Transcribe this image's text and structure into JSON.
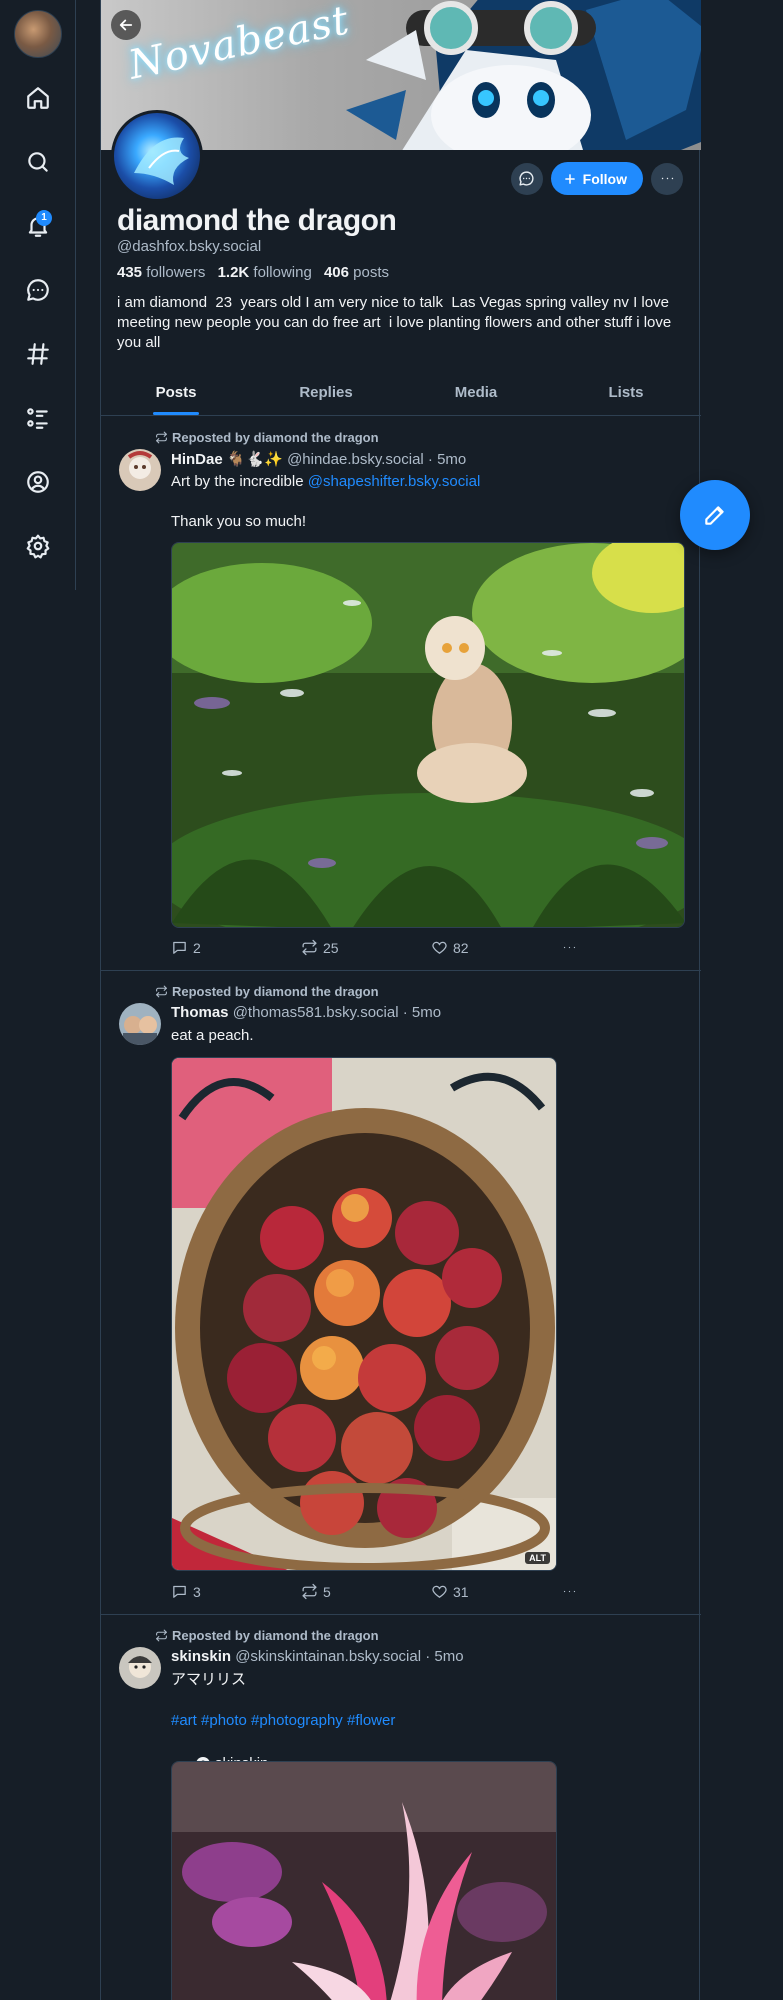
{
  "nav": {
    "notifications_badge": "1",
    "items": [
      "home",
      "search",
      "notifications",
      "chat",
      "feeds",
      "lists",
      "profile",
      "settings"
    ]
  },
  "banner": {
    "signature": "Novabeast"
  },
  "profile": {
    "display_name": "diamond the dragon",
    "handle": "@dashfox.bsky.social",
    "followers_count": "435",
    "followers_label": "followers",
    "following_count": "1.2K",
    "following_label": "following",
    "posts_count": "406",
    "posts_label": "posts",
    "bio": "i am diamond  23  years old I am very nice to talk  Las Vegas spring valley nv I love meeting new people you can do free art  i love planting flowers and other stuff i love you all",
    "follow_label": "Follow"
  },
  "tabs": [
    {
      "label": "Posts",
      "active": true
    },
    {
      "label": "Replies",
      "active": false
    },
    {
      "label": "Media",
      "active": false
    },
    {
      "label": "Lists",
      "active": false
    }
  ],
  "posts": [
    {
      "repost_label": "Reposted by diamond the dragon",
      "author_name": "HinDae 🐐🐇✨",
      "author_handle": "@hindae.bsky.social",
      "age": "5mo",
      "text_before_link": "Art by the incredible ",
      "link": "@shapeshifter.bsky.social",
      "text_after": "Thank you so much!",
      "replies": "2",
      "reposts": "25",
      "likes": "82"
    },
    {
      "repost_label": "Reposted by diamond the dragon",
      "author_name": "Thomas",
      "author_handle": "@thomas581.bsky.social",
      "age": "5mo",
      "text": "eat a peach.",
      "alt_badge": "ALT",
      "replies": "3",
      "reposts": "5",
      "likes": "31"
    },
    {
      "repost_label": "Reposted by diamond the dragon",
      "author_name": "skinskin",
      "author_handle": "@skinskintainan.bsky.social",
      "age": "5mo",
      "text": "アマリリス",
      "hashtags": "#art #photo #photography #flower",
      "label_chip": "skinskin"
    }
  ],
  "colors": {
    "accent": "#208bfe",
    "background": "#161e27",
    "border": "#2e4052",
    "muted": "#aebbc9"
  }
}
